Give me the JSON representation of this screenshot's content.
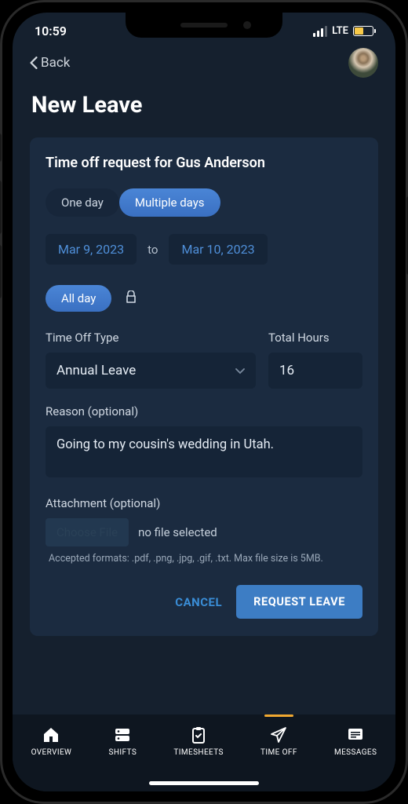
{
  "status": {
    "time": "10:59",
    "network": "LTE"
  },
  "header": {
    "back": "Back"
  },
  "page": {
    "title": "New Leave"
  },
  "form": {
    "heading": "Time off request for Gus Anderson",
    "duration_tabs": {
      "one": "One day",
      "multi": "Multiple days"
    },
    "start_date": "Mar 9, 2023",
    "to": "to",
    "end_date": "Mar 10, 2023",
    "all_day": "All day",
    "type_label": "Time Off Type",
    "type_value": "Annual Leave",
    "hours_label": "Total Hours",
    "hours_value": "16",
    "reason_label": "Reason (optional)",
    "reason_value": "Going to my cousin's wedding in Utah.",
    "attach_label": "Attachment (optional)",
    "choose_file": "Choose File",
    "no_file": "no file selected",
    "hint": "Accepted formats: .pdf, .png, .jpg, .gif, .txt. Max file size is 5MB.",
    "cancel": "CANCEL",
    "submit": "REQUEST LEAVE"
  },
  "nav": {
    "overview": "OVERVIEW",
    "shifts": "SHIFTS",
    "timesheets": "TIMESHEETS",
    "timeoff": "TIME OFF",
    "messages": "MESSAGES"
  }
}
